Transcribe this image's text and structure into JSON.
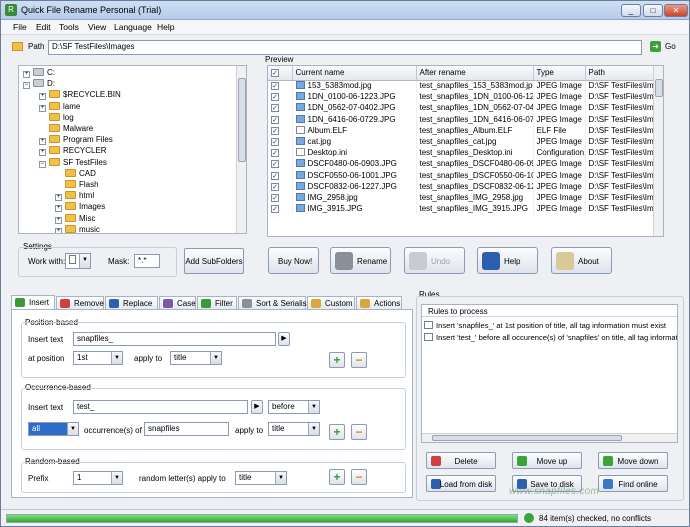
{
  "window": {
    "title": "Quick File Rename Personal (Trial)",
    "controls": [
      "_",
      "□",
      "✕"
    ]
  },
  "menu": [
    "File",
    "Edit",
    "Tools",
    "View",
    "Language",
    "Help"
  ],
  "path": {
    "label": "Path",
    "value": "D:\\SF TestFiles\\Images",
    "go_label": "Go"
  },
  "tree": {
    "items": [
      {
        "label": "C:",
        "expander": "+"
      },
      {
        "label": "D:",
        "expander": "−"
      },
      {
        "label": "$RECYCLE.BIN",
        "expander": "+"
      },
      {
        "label": "lame",
        "expander": "+"
      },
      {
        "label": "log",
        "expander": ""
      },
      {
        "label": "Malware",
        "expander": ""
      },
      {
        "label": "Program Files",
        "expander": "+"
      },
      {
        "label": "RECYCLER",
        "expander": "+"
      },
      {
        "label": "SF TestFiles",
        "expander": "−"
      },
      {
        "label": "CAD",
        "expander": ""
      },
      {
        "label": "Flash",
        "expander": ""
      },
      {
        "label": "html",
        "expander": "+"
      },
      {
        "label": "Images",
        "expander": "+"
      },
      {
        "label": "Misc",
        "expander": "+"
      },
      {
        "label": "music",
        "expander": "+"
      }
    ]
  },
  "settings": {
    "title": "Settings",
    "workwith_label": "Work with:",
    "mask_label": "Mask:",
    "mask_value": "*.*",
    "add_subfolders": "Add SubFolders"
  },
  "preview": {
    "title": "Preview",
    "columns": [
      "Current name",
      "After rename",
      "Type",
      "Path"
    ],
    "rows": [
      {
        "current": "153_5383mod.jpg",
        "after": "test_snapfiles_153_5383mod.jpg",
        "type": "JPEG Image",
        "path": "D:\\SF TestFiles\\Images\\"
      },
      {
        "current": "1DN_0100-06-1223.JPG",
        "after": "test_snapfiles_1DN_0100-06-1223.JPG",
        "type": "JPEG Image",
        "path": "D:\\SF TestFiles\\Images\\"
      },
      {
        "current": "1DN_0562-07-0402.JPG",
        "after": "test_snapfiles_1DN_0562-07-0402.JPG",
        "type": "JPEG Image",
        "path": "D:\\SF TestFiles\\Images\\"
      },
      {
        "current": "1DN_6416-06-0729.JPG",
        "after": "test_snapfiles_1DN_6416-06-0729.JPG",
        "type": "JPEG Image",
        "path": "D:\\SF TestFiles\\Images\\"
      },
      {
        "current": "Album.ELF",
        "after": "test_snapfiles_Album.ELF",
        "type": "ELF File",
        "path": "D:\\SF TestFiles\\Images\\"
      },
      {
        "current": "cat.jpg",
        "after": "test_snapfiles_cat.jpg",
        "type": "JPEG Image",
        "path": "D:\\SF TestFiles\\Images\\"
      },
      {
        "current": "Desktop.ini",
        "after": "test_snapfiles_Desktop.ini",
        "type": "Configuration...",
        "path": "D:\\SF TestFiles\\Images\\"
      },
      {
        "current": "DSCF0480-06-0903.JPG",
        "after": "test_snapfiles_DSCF0480-06-0903.JPG",
        "type": "JPEG Image",
        "path": "D:\\SF TestFiles\\Images\\"
      },
      {
        "current": "DSCF0550-06-1001.JPG",
        "after": "test_snapfiles_DSCF0550-06-1001.JPG",
        "type": "JPEG Image",
        "path": "D:\\SF TestFiles\\Images\\"
      },
      {
        "current": "DSCF0832-06-1227.JPG",
        "after": "test_snapfiles_DSCF0832-06-1227.JPG",
        "type": "JPEG Image",
        "path": "D:\\SF TestFiles\\Images\\"
      },
      {
        "current": "IMG_2958.jpg",
        "after": "test_snapfiles_IMG_2958.jpg",
        "type": "JPEG Image",
        "path": "D:\\SF TestFiles\\Images\\"
      },
      {
        "current": "IMG_3915.JPG",
        "after": "test_snapfiles_IMG_3915.JPG",
        "type": "JPEG Image",
        "path": "D:\\SF TestFiles\\Images\\"
      }
    ]
  },
  "actions": {
    "buy": "Buy Now!",
    "rename": "Rename",
    "undo": "Undo",
    "help": "Help",
    "about": "About"
  },
  "tabs": [
    "Insert",
    "Remove",
    "Replace",
    "Case",
    "Filter",
    "Sort & Serialise",
    "Custom",
    "Actions"
  ],
  "insert": {
    "position_based": {
      "title": "Position-based",
      "insert_text_label": "Insert text",
      "insert_text_value": "snapfiles_",
      "at_position_label": "at position",
      "at_position_value": "1st",
      "apply_to_label": "apply to",
      "apply_to_value": "title"
    },
    "occurrence_based": {
      "title": "Occurrence-based",
      "insert_text_label": "Insert text",
      "insert_text_value": "test_",
      "before_value": "before",
      "occurrence_value": "all",
      "occurrence_label": "occurrence(s) of",
      "occurrence_text": "snapfiles",
      "apply_to_label": "apply to",
      "apply_to_value": "title"
    },
    "random_based": {
      "title": "Random-based",
      "prefix_label": "Prefix",
      "prefix_value": "1",
      "random_label": "random letter(s) apply to",
      "apply_to_value": "title"
    }
  },
  "rules": {
    "title": "Rules",
    "header": "Rules to process",
    "items": [
      "Insert 'snapfiles_' at 1st position of title, all tag information must exist",
      "Insert 'test_' before all occurence(s) of 'snapfiles' on title, all tag information"
    ],
    "buttons": {
      "delete": "Delete",
      "move_up": "Move up",
      "move_down": "Move down",
      "load": "Load from disk",
      "save": "Save to disk",
      "find_online": "Find online"
    }
  },
  "status": {
    "text": "84 item(s) checked, no conflicts",
    "progress": 1.0
  },
  "watermark": "www.snapfiles.com",
  "colors": {
    "accent": "#3a8a3a",
    "selection": "#2d6cc8",
    "progress": "#38b838"
  }
}
